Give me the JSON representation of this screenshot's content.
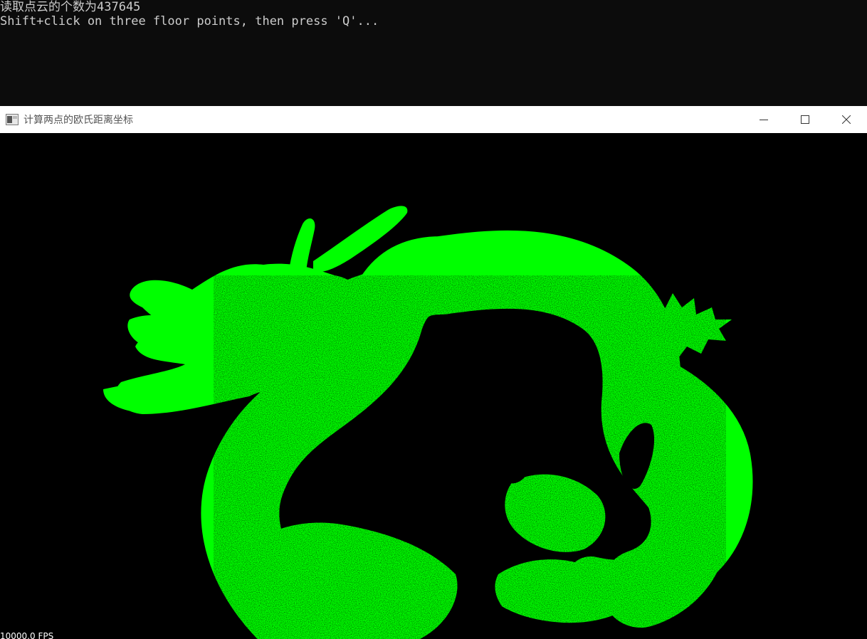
{
  "console": {
    "lines": [
      "读取点云的个数为437645",
      "Shift+click on three floor points, then press 'Q'..."
    ]
  },
  "viewer": {
    "title": "计算两点的欧氏距离坐标",
    "fps": "10000.0 FPS",
    "point_color": "#00ff00",
    "background_color": "#000000"
  }
}
